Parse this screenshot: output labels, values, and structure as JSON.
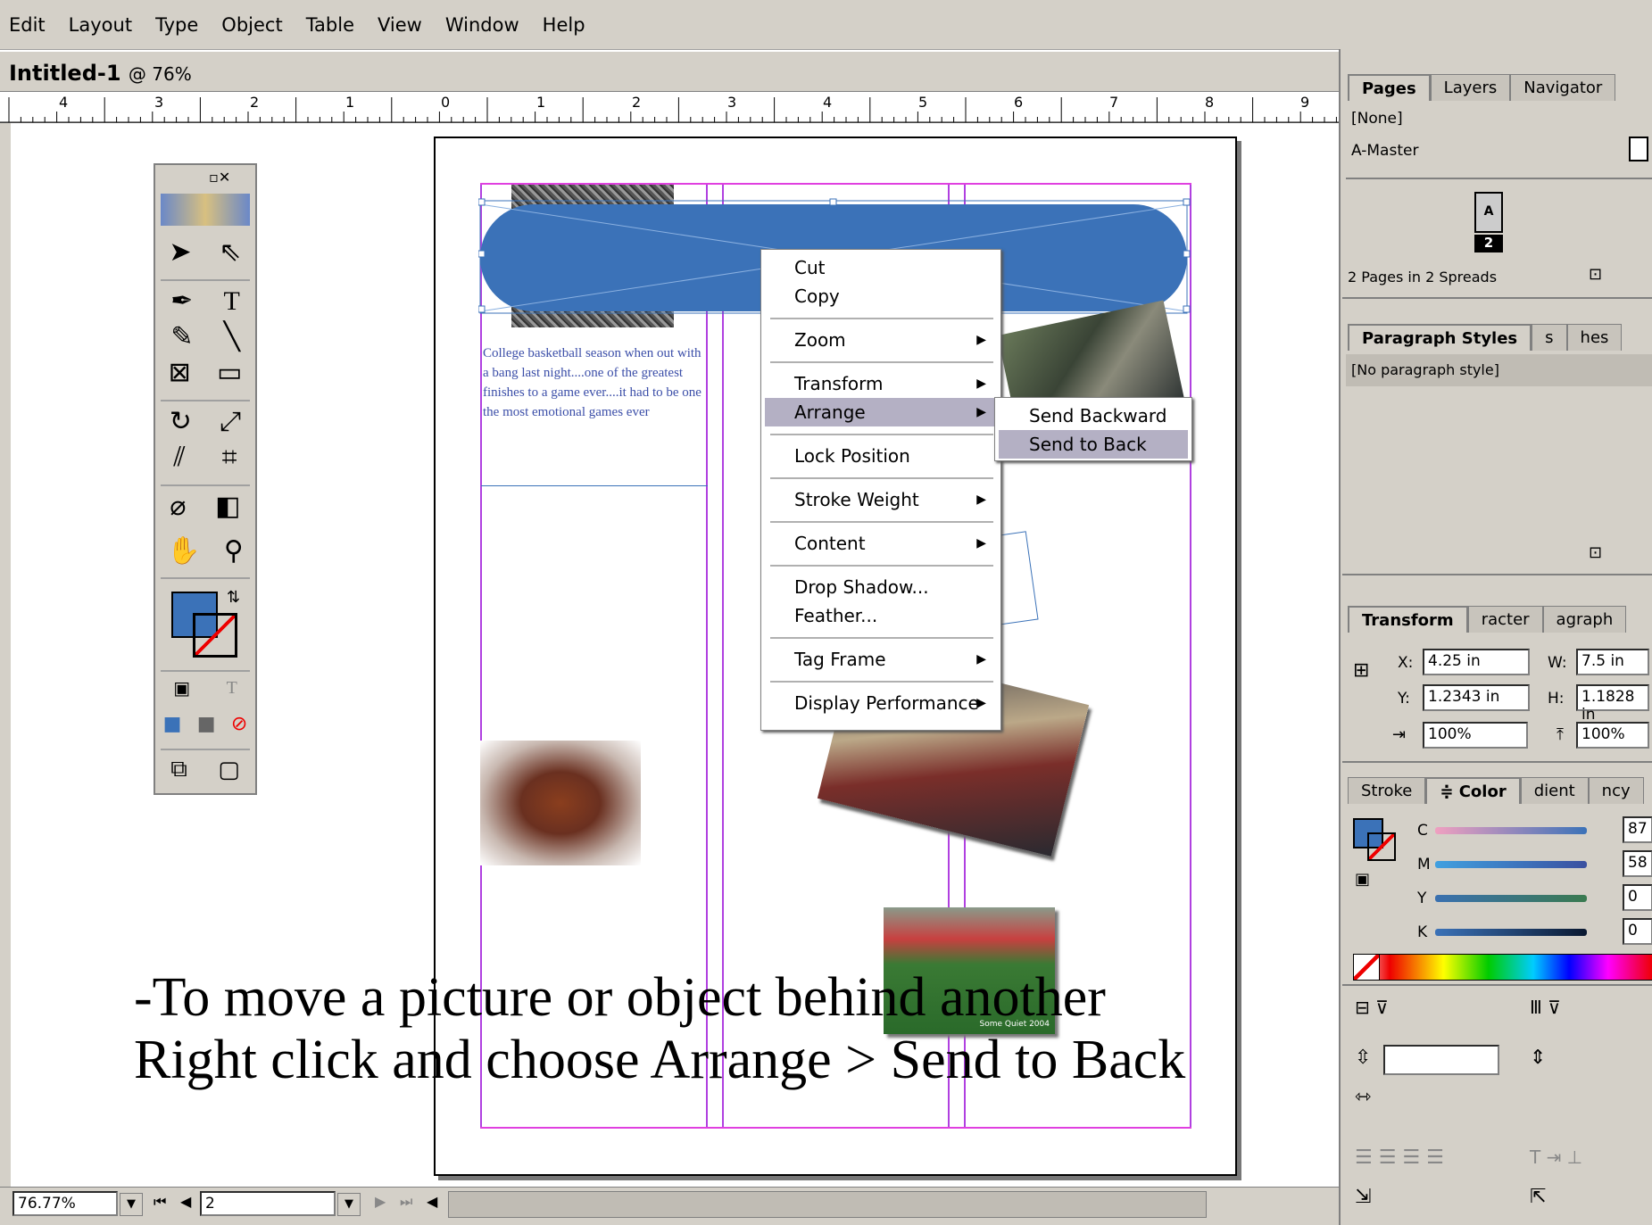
{
  "menubar": {
    "items": [
      "Edit",
      "Layout",
      "Type",
      "Object",
      "Table",
      "View",
      "Window",
      "Help"
    ]
  },
  "document": {
    "title": "Intitled-1",
    "zoom_label": "@ 76%"
  },
  "ruler": {
    "ticks": [
      "4",
      "3",
      "2",
      "1",
      "0",
      "1",
      "2",
      "3",
      "4",
      "5",
      "6",
      "7",
      "8",
      "9"
    ]
  },
  "page_text": {
    "article": "College basketball season when out with a bang last night....one of the greatest finishes to a game ever....it had to be one the most emotional games ever",
    "photo_caption": "Some Quiet 2004"
  },
  "context_menu": {
    "items": [
      {
        "label": "Cut",
        "submenu": false
      },
      {
        "label": "Copy",
        "submenu": false
      },
      {
        "label": "Zoom",
        "submenu": true
      },
      {
        "label": "Transform",
        "submenu": true
      },
      {
        "label": "Arrange",
        "submenu": true,
        "highlighted": true
      },
      {
        "label": "Lock Position",
        "submenu": false
      },
      {
        "label": "Stroke Weight",
        "submenu": true
      },
      {
        "label": "Content",
        "submenu": true
      },
      {
        "label": "Drop Shadow...",
        "submenu": false
      },
      {
        "label": "Feather...",
        "submenu": false
      },
      {
        "label": "Tag Frame",
        "submenu": true
      },
      {
        "label": "Display Performance",
        "submenu": true
      }
    ],
    "submenu_arrow": "▶"
  },
  "arrange_submenu": {
    "items": [
      {
        "label": "Send Backward",
        "highlighted": false
      },
      {
        "label": "Send to Back",
        "highlighted": true
      }
    ]
  },
  "pages_panel": {
    "tabs": [
      "Pages",
      "Layers",
      "Navigator"
    ],
    "items": [
      "[None]",
      "A-Master"
    ],
    "spread_label": "A",
    "page_number": "2",
    "footer": "2 Pages in 2 Spreads"
  },
  "paragraph_panel": {
    "tabs": [
      "Paragraph Styles",
      "s",
      "hes"
    ],
    "items": [
      "[No paragraph style]"
    ]
  },
  "transform_panel": {
    "tabs": [
      "Transform",
      "racter",
      "agraph"
    ],
    "x_label": "X:",
    "x": "4.25 in",
    "y_label": "Y:",
    "y": "1.2343 in",
    "w_label": "W:",
    "w": "7.5 in",
    "h_label": "H:",
    "h": "1.1828 in",
    "scale_x": "100%",
    "scale_y": "100%"
  },
  "color_panel": {
    "tabs": [
      "Stroke",
      "≑ Color",
      "dient",
      "ncy"
    ],
    "channels": [
      {
        "label": "C",
        "value": "87"
      },
      {
        "label": "M",
        "value": "58"
      },
      {
        "label": "Y",
        "value": "0"
      },
      {
        "label": "K",
        "value": "0"
      }
    ],
    "fill_color": "#3b72b8"
  },
  "statusbar": {
    "zoom": "76.77%",
    "page": "2"
  },
  "instruction": {
    "line1": "-To move a picture or object behind another",
    "line2": "Right click and choose Arrange > Send to Back"
  },
  "colors": {
    "accent_blue": "#3b72b8",
    "highlight": "#b4b0c4",
    "chrome": "#d4d0c8",
    "guide": "#b040e0"
  }
}
